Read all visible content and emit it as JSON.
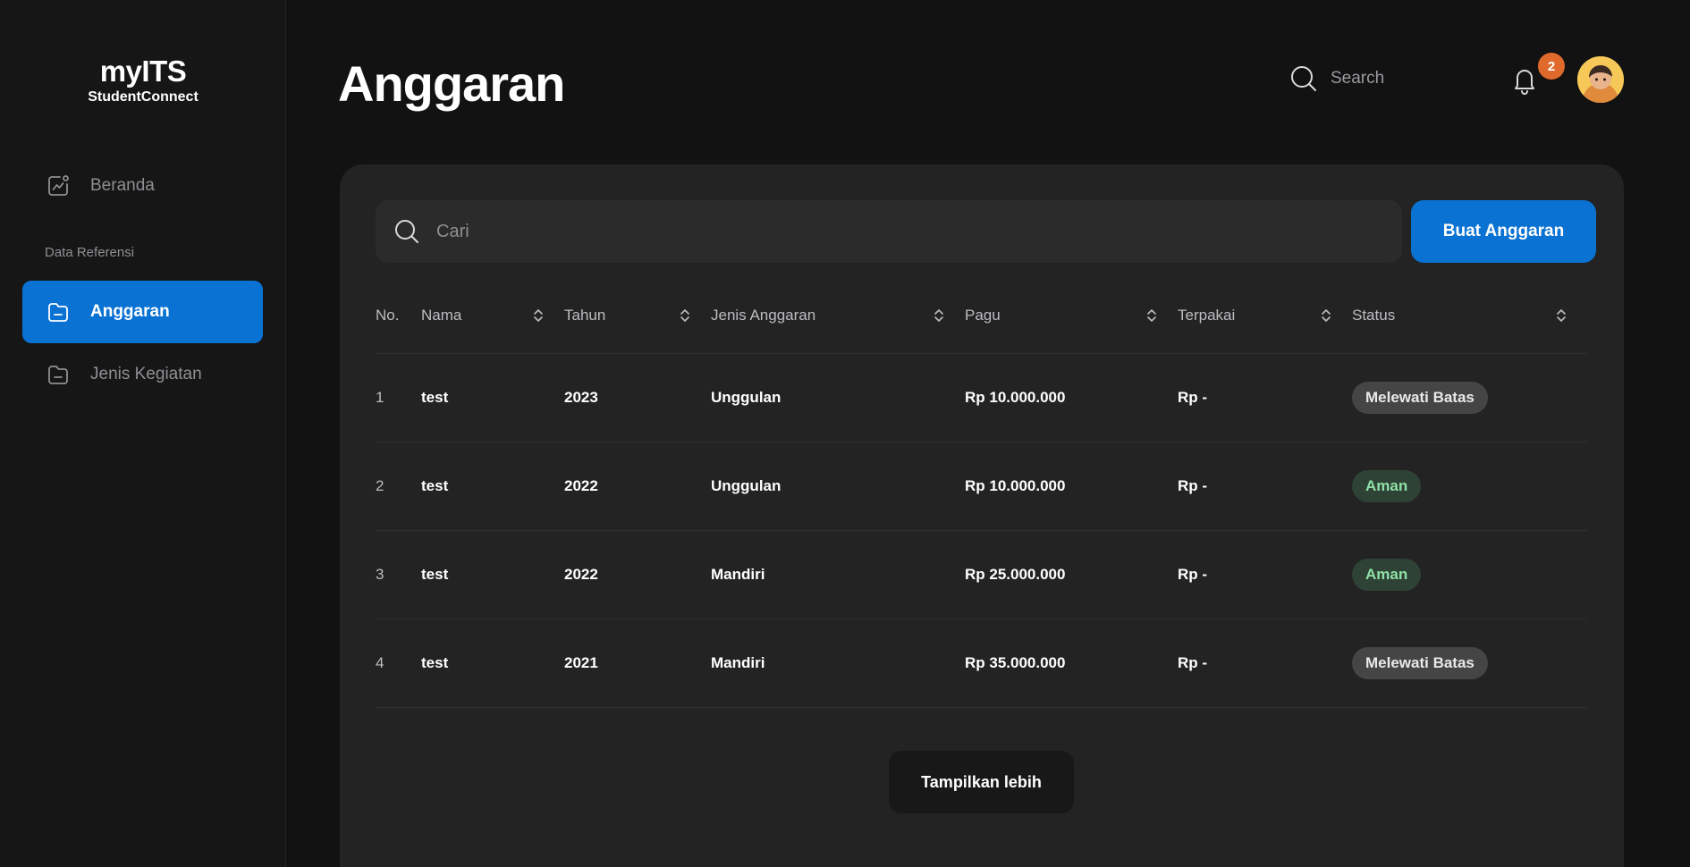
{
  "brand": {
    "name": "myITS",
    "sub": "StudentConnect"
  },
  "sidebar": {
    "items": [
      {
        "label": "Beranda",
        "icon": "chart-icon"
      },
      {
        "label": "Anggaran",
        "icon": "folder-icon",
        "active": true
      },
      {
        "label": "Jenis Kegiatan",
        "icon": "folder-icon"
      }
    ],
    "section_label": "Data Referensi"
  },
  "header": {
    "title": "Anggaran",
    "search_label": "Search",
    "notification_count": "2"
  },
  "toolbar": {
    "search_placeholder": "Cari",
    "create_label": "Buat Anggaran"
  },
  "table": {
    "columns": [
      "No.",
      "Nama",
      "Tahun",
      "Jenis Anggaran",
      "Pagu",
      "Terpakai",
      "Status"
    ],
    "rows": [
      {
        "no": "1",
        "nama": "test",
        "tahun": "2023",
        "jenis": "Unggulan",
        "pagu": "Rp 10.000.000",
        "terpakai": "Rp -",
        "status": "Melewati Batas"
      },
      {
        "no": "2",
        "nama": "test",
        "tahun": "2022",
        "jenis": "Unggulan",
        "pagu": "Rp 10.000.000",
        "terpakai": "Rp -",
        "status": "Aman"
      },
      {
        "no": "3",
        "nama": "test",
        "tahun": "2022",
        "jenis": "Mandiri",
        "pagu": "Rp 25.000.000",
        "terpakai": "Rp -",
        "status": "Aman"
      },
      {
        "no": "4",
        "nama": "test",
        "tahun": "2021",
        "jenis": "Mandiri",
        "pagu": "Rp 35.000.000",
        "terpakai": "Rp -",
        "status": "Melewati Batas"
      }
    ]
  },
  "more_label": "Tampilkan lebih",
  "colors": {
    "accent": "#0a72d3",
    "badge": "#e06a2c",
    "status_ok_text": "#8fe0a6",
    "status_ok_bg": "#2f4236",
    "status_warn_bg": "#454545"
  }
}
